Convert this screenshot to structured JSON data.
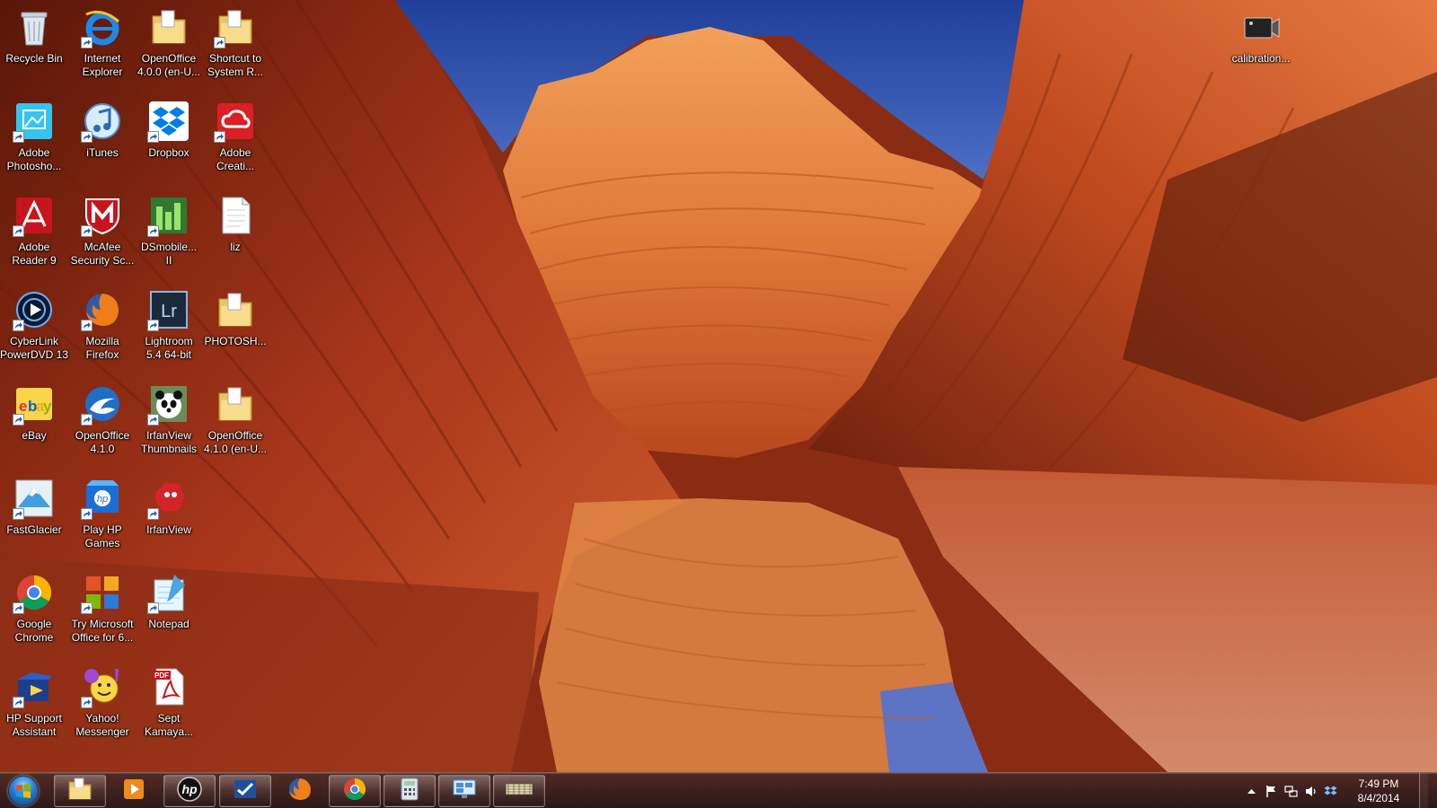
{
  "desktop": {
    "icons": [
      {
        "id": "recycle-bin",
        "label": "Recycle Bin",
        "icon": "recycle-bin-icon",
        "shortcut": false
      },
      {
        "id": "internet-explorer",
        "label": "Internet\nExplorer",
        "icon": "internet-explorer-icon",
        "shortcut": true
      },
      {
        "id": "openoffice-400",
        "label": "OpenOffice\n4.0.0 (en-U...",
        "icon": "folder-icon",
        "shortcut": false
      },
      {
        "id": "shortcut-system-r",
        "label": "Shortcut to\nSystem R...",
        "icon": "folder-icon",
        "shortcut": true
      },
      {
        "id": "adobe-photoshop",
        "label": "Adobe\nPhotosho...",
        "icon": "adobe-photoshop-icon",
        "shortcut": true
      },
      {
        "id": "itunes",
        "label": "iTunes",
        "icon": "itunes-icon",
        "shortcut": true
      },
      {
        "id": "dropbox",
        "label": "Dropbox",
        "icon": "dropbox-icon",
        "shortcut": true
      },
      {
        "id": "adobe-creative-cloud",
        "label": "Adobe\nCreati...",
        "icon": "adobe-creative-cloud-icon",
        "shortcut": true
      },
      {
        "id": "adobe-reader",
        "label": "Adobe\nReader 9",
        "icon": "adobe-reader-icon",
        "shortcut": true
      },
      {
        "id": "mcafee",
        "label": "McAfee\nSecurity Sc...",
        "icon": "mcafee-icon",
        "shortcut": true
      },
      {
        "id": "dsmobile",
        "label": "DSmobile...\nII",
        "icon": "dsmobile-icon",
        "shortcut": true
      },
      {
        "id": "liz",
        "label": "liz",
        "icon": "text-file-icon",
        "shortcut": false
      },
      {
        "id": "cyberlink",
        "label": "CyberLink\nPowerDVD 13",
        "icon": "powerdvd-icon",
        "shortcut": true
      },
      {
        "id": "firefox",
        "label": "Mozilla\nFirefox",
        "icon": "firefox-icon",
        "shortcut": true
      },
      {
        "id": "lightroom",
        "label": "Lightroom\n5.4 64-bit",
        "icon": "lightroom-icon",
        "shortcut": true
      },
      {
        "id": "photoshop-folder",
        "label": "PHOTOSH...",
        "icon": "folder-icon",
        "shortcut": false
      },
      {
        "id": "ebay",
        "label": "eBay",
        "icon": "ebay-icon",
        "shortcut": true
      },
      {
        "id": "openoffice-410",
        "label": "OpenOffice\n4.1.0",
        "icon": "openoffice-icon",
        "shortcut": true
      },
      {
        "id": "irfanview-thumbnails",
        "label": "IrfanView\nThumbnails",
        "icon": "panda-icon",
        "shortcut": true
      },
      {
        "id": "openoffice-410-folder",
        "label": "OpenOffice\n4.1.0 (en-U...",
        "icon": "folder-icon",
        "shortcut": false
      },
      {
        "id": "fastglacier",
        "label": "FastGlacier",
        "icon": "fastglacier-icon",
        "shortcut": true
      },
      {
        "id": "play-hp-games",
        "label": "Play HP\nGames",
        "icon": "hp-games-icon",
        "shortcut": true
      },
      {
        "id": "irfanview",
        "label": "IrfanView",
        "icon": "irfanview-icon",
        "shortcut": true
      },
      {
        "id": "google-chrome",
        "label": "Google\nChrome",
        "icon": "chrome-icon",
        "shortcut": true
      },
      {
        "id": "try-office",
        "label": "Try Microsoft\nOffice for 6...",
        "icon": "office-icon",
        "shortcut": true
      },
      {
        "id": "notepad",
        "label": "Notepad",
        "icon": "notepad-icon",
        "shortcut": true
      },
      {
        "id": "hp-support",
        "label": "HP Support\nAssistant",
        "icon": "hp-support-icon",
        "shortcut": true
      },
      {
        "id": "yahoo-messenger",
        "label": "Yahoo!\nMessenger",
        "icon": "yahoo-messenger-icon",
        "shortcut": true
      },
      {
        "id": "sept-kamaya",
        "label": "Sept\nKamaya...",
        "icon": "pdf-file-icon",
        "shortcut": false
      },
      {
        "id": "calibration",
        "label": "calibration...",
        "icon": "video-file-icon",
        "shortcut": false
      }
    ]
  },
  "taskbar": {
    "pinned": [
      {
        "id": "windows-explorer",
        "icon": "folder-icon"
      },
      {
        "id": "media-player",
        "icon": "media-player-icon"
      },
      {
        "id": "hp",
        "icon": "hp-icon"
      },
      {
        "id": "app-check",
        "icon": "checkmark-icon"
      },
      {
        "id": "firefox",
        "icon": "firefox-icon"
      },
      {
        "id": "chrome",
        "icon": "chrome-icon"
      },
      {
        "id": "calculator",
        "icon": "calculator-icon"
      },
      {
        "id": "remote-desktop",
        "icon": "remote-desktop-icon"
      },
      {
        "id": "pictures",
        "icon": "thumbnail-strip-icon"
      }
    ],
    "clock": {
      "time": "7:49 PM",
      "date": "8/4/2014"
    }
  },
  "colors": {
    "taskbar": "#2a1e22",
    "start_orb": "#2a7bd0",
    "wallpaper_sky": "#2c4fa8",
    "wallpaper_rock": "#c8501e"
  }
}
